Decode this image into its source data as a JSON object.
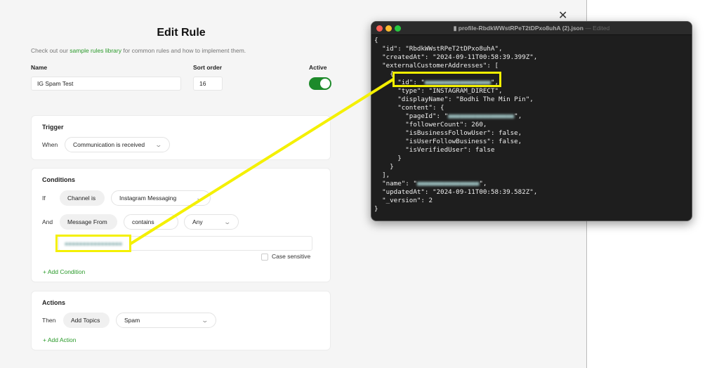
{
  "form": {
    "title": "Edit Rule",
    "intro_prefix": "Check out our ",
    "intro_link": "sample rules library",
    "intro_suffix": " for common rules and how to implement them.",
    "name_label": "Name",
    "name_value": "IG Spam Test",
    "sort_label": "Sort order",
    "sort_value": "16",
    "active_label": "Active",
    "active": true
  },
  "trigger": {
    "title": "Trigger",
    "when": "When",
    "event": "Communication is received"
  },
  "conditions": {
    "title": "Conditions",
    "if": "If",
    "field1": "Channel is",
    "value1": "Instagram Messaging",
    "and": "And",
    "field2": "Message From",
    "operator": "contains",
    "match": "Any",
    "case_sensitive": "Case sensitive",
    "case_sensitive_checked": false,
    "add": "+ Add Condition"
  },
  "actions": {
    "title": "Actions",
    "then": "Then",
    "action": "Add Topics",
    "value": "Spam",
    "add": "+ Add Action"
  },
  "editor": {
    "title": "profile-RbdkWWstRPeT2tDPxo8uhA (2).json",
    "status": " — Edited",
    "lines": [
      "{",
      "  \"id\": \"RbdkWWstRPeT2tDPxo8uhA\",",
      "  \"createdAt\": \"2024-09-11T00:58:39.399Z\",",
      "  \"externalCustomerAddresses\": [",
      "    {",
      "      \"id\": \"",
      "      \"type\": \"INSTAGRAM_DIRECT\",",
      "      \"displayName\": \"Bodhi The Min Pin\",",
      "      \"content\": {",
      "        \"pageId\": \"",
      "        \"followerCount\": 260,",
      "        \"isBusinessFollowUser\": false,",
      "        \"isUserFollowBusiness\": false,",
      "        \"isVerifiedUser\": false",
      "      }",
      "    }",
      "  ],",
      "  \"name\": \"",
      "  \"updatedAt\": \"2024-09-11T00:58:39.582Z\",",
      "  \"_version\": 2",
      "}"
    ]
  },
  "colors": {
    "accent": "#1d8a2a",
    "highlight": "#f4f000"
  }
}
